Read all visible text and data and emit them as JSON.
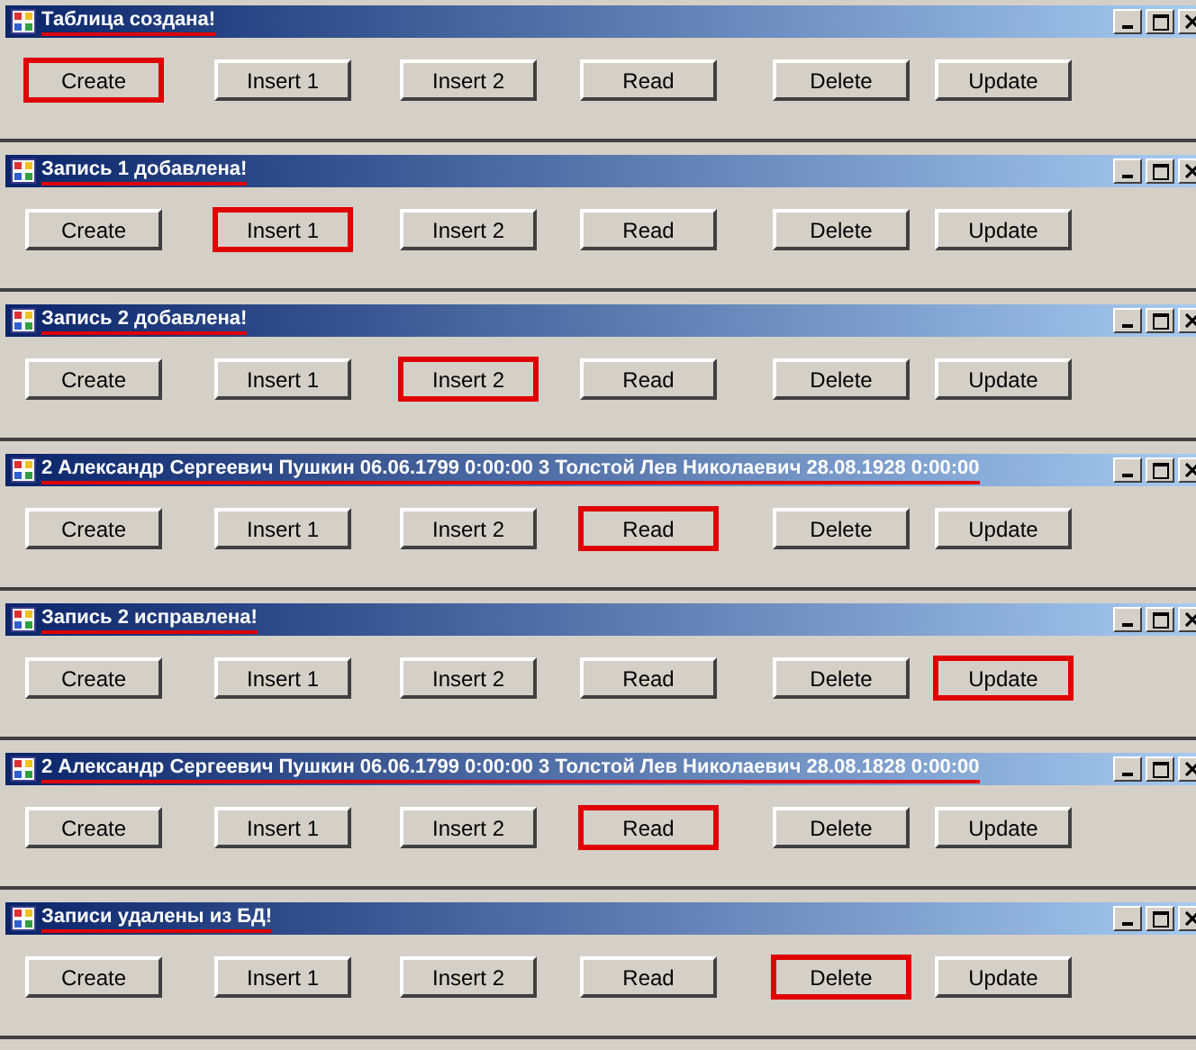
{
  "windows": [
    {
      "title": "Таблица создана!",
      "buttons": [
        {
          "label": "Create",
          "selected": true
        },
        {
          "label": "Insert 1",
          "selected": false
        },
        {
          "label": "Insert 2",
          "selected": false
        },
        {
          "label": "Read",
          "selected": false
        },
        {
          "label": "Delete",
          "selected": false
        },
        {
          "label": "Update",
          "selected": false
        }
      ]
    },
    {
      "title": "Запись 1 добавлена!",
      "buttons": [
        {
          "label": "Create",
          "selected": false
        },
        {
          "label": "Insert 1",
          "selected": true
        },
        {
          "label": "Insert 2",
          "selected": false
        },
        {
          "label": "Read",
          "selected": false
        },
        {
          "label": "Delete",
          "selected": false
        },
        {
          "label": "Update",
          "selected": false
        }
      ]
    },
    {
      "title": "Запись 2 добавлена!",
      "buttons": [
        {
          "label": "Create",
          "selected": false
        },
        {
          "label": "Insert 1",
          "selected": false
        },
        {
          "label": "Insert 2",
          "selected": true
        },
        {
          "label": "Read",
          "selected": false
        },
        {
          "label": "Delete",
          "selected": false
        },
        {
          "label": "Update",
          "selected": false
        }
      ]
    },
    {
      "title": "2  Александр Сергеевич Пушкин  06.06.1799 0:00:00 3  Толстой Лев Николаевич  28.08.1928 0:00:00",
      "buttons": [
        {
          "label": "Create",
          "selected": false
        },
        {
          "label": "Insert 1",
          "selected": false
        },
        {
          "label": "Insert 2",
          "selected": false
        },
        {
          "label": "Read",
          "selected": true
        },
        {
          "label": "Delete",
          "selected": false
        },
        {
          "label": "Update",
          "selected": false
        }
      ]
    },
    {
      "title": "Запись 2 исправлена!",
      "buttons": [
        {
          "label": "Create",
          "selected": false
        },
        {
          "label": "Insert 1",
          "selected": false
        },
        {
          "label": "Insert 2",
          "selected": false
        },
        {
          "label": "Read",
          "selected": false
        },
        {
          "label": "Delete",
          "selected": false
        },
        {
          "label": "Update",
          "selected": true
        }
      ]
    },
    {
      "title": "2  Александр Сергеевич Пушкин  06.06.1799 0:00:00 3  Толстой Лев Николаевич  28.08.1828 0:00:00",
      "buttons": [
        {
          "label": "Create",
          "selected": false
        },
        {
          "label": "Insert 1",
          "selected": false
        },
        {
          "label": "Insert 2",
          "selected": false
        },
        {
          "label": "Read",
          "selected": true
        },
        {
          "label": "Delete",
          "selected": false
        },
        {
          "label": "Update",
          "selected": false
        }
      ]
    },
    {
      "title": "Записи удалены из БД!",
      "buttons": [
        {
          "label": "Create",
          "selected": false
        },
        {
          "label": "Insert 1",
          "selected": false
        },
        {
          "label": "Insert 2",
          "selected": false
        },
        {
          "label": "Read",
          "selected": false
        },
        {
          "label": "Delete",
          "selected": true
        },
        {
          "label": "Update",
          "selected": false
        }
      ]
    }
  ]
}
